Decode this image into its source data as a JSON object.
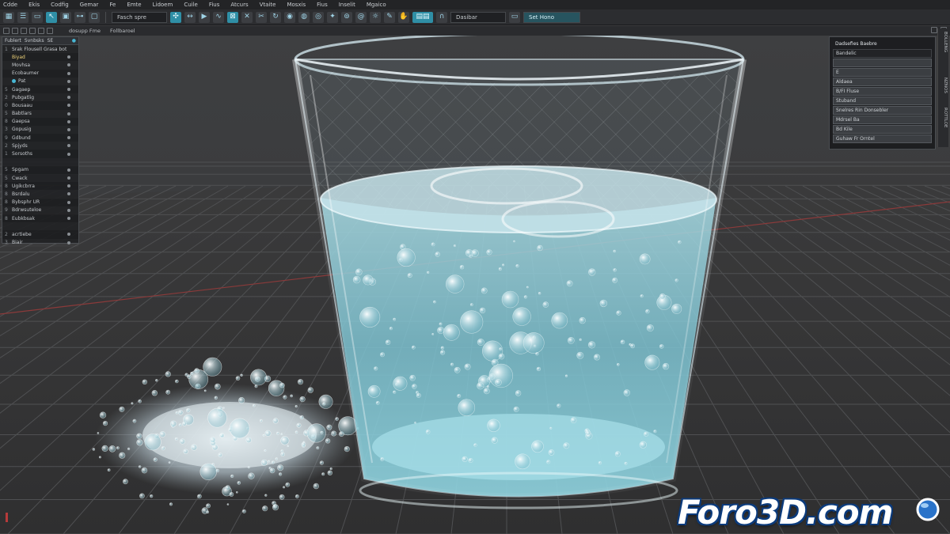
{
  "menu": [
    "Cdde",
    "Ekis",
    "Codfig",
    "Gemar",
    "Fe",
    "Emte",
    "Lidoem",
    "Cuile",
    "Fius",
    "Atcurs",
    "Vtaite",
    "Mosxis",
    "Fius",
    "Inselit",
    "Mgaico"
  ],
  "toolbar": {
    "field1": "Fasch spre",
    "field2": "Dasibar",
    "field3": "Set Hono"
  },
  "subbar": {
    "text1": "dosupp Fme",
    "text2": "Follbaroel"
  },
  "outliner": {
    "header": [
      "Fublert",
      "Svnbsks",
      "SE"
    ],
    "items": [
      {
        "idx": "1",
        "label": "Srak Flousell Grasa bot"
      },
      {
        "idx": "",
        "label": "Biyad",
        "selected": true
      },
      {
        "idx": "",
        "label": "Movhsa"
      },
      {
        "idx": "",
        "label": "Ecobaumer"
      },
      {
        "idx": "",
        "label": "Pat"
      },
      {
        "idx": "5",
        "label": "Gagaep"
      },
      {
        "idx": "2",
        "label": "Pubgatlig"
      },
      {
        "idx": "0",
        "label": "Bousaau"
      },
      {
        "idx": "5",
        "label": "Babtlars"
      },
      {
        "idx": "8",
        "label": "Gaepsa"
      },
      {
        "idx": "3",
        "label": "Gopusig"
      },
      {
        "idx": "9",
        "label": "Gdbund"
      },
      {
        "idx": "2",
        "label": "Spjyds"
      },
      {
        "idx": "1",
        "label": "Sorsoths"
      },
      {
        "idx": "",
        "label": ""
      },
      {
        "idx": "5",
        "label": "Spgam"
      },
      {
        "idx": "5",
        "label": "Cwack"
      },
      {
        "idx": "8",
        "label": "Ugikcbrra"
      },
      {
        "idx": "8",
        "label": "Bsrdalu"
      },
      {
        "idx": "8",
        "label": "Bybsphr UR"
      },
      {
        "idx": "9",
        "label": "Bdrwsuteloe"
      },
      {
        "idx": "8",
        "label": "Eubkbsak"
      },
      {
        "idx": "",
        "label": ""
      },
      {
        "idx": "2",
        "label": "acrtiebe"
      },
      {
        "idx": "3",
        "label": "Biair"
      }
    ]
  },
  "props": {
    "header": "Dadsefies Baebre",
    "rows": [
      "Bandelic",
      "",
      "E",
      "Aldaea",
      "B/FI Fluse",
      "Stuband",
      "Snelres Rin Donsebler",
      "Mdrsel Ba",
      "Bd Kile",
      "Guhaw Fr Orntel"
    ]
  },
  "sidetabs": [
    "BOLLENG",
    "NZNOS",
    "ROTTLOE"
  ],
  "watermark": {
    "text": "Foro3D.com"
  },
  "colors": {
    "accent": "#2f8fa6",
    "water": "#7fc7d6",
    "grid": "#4a4b4d",
    "redAxis": "#8b3a3a"
  }
}
